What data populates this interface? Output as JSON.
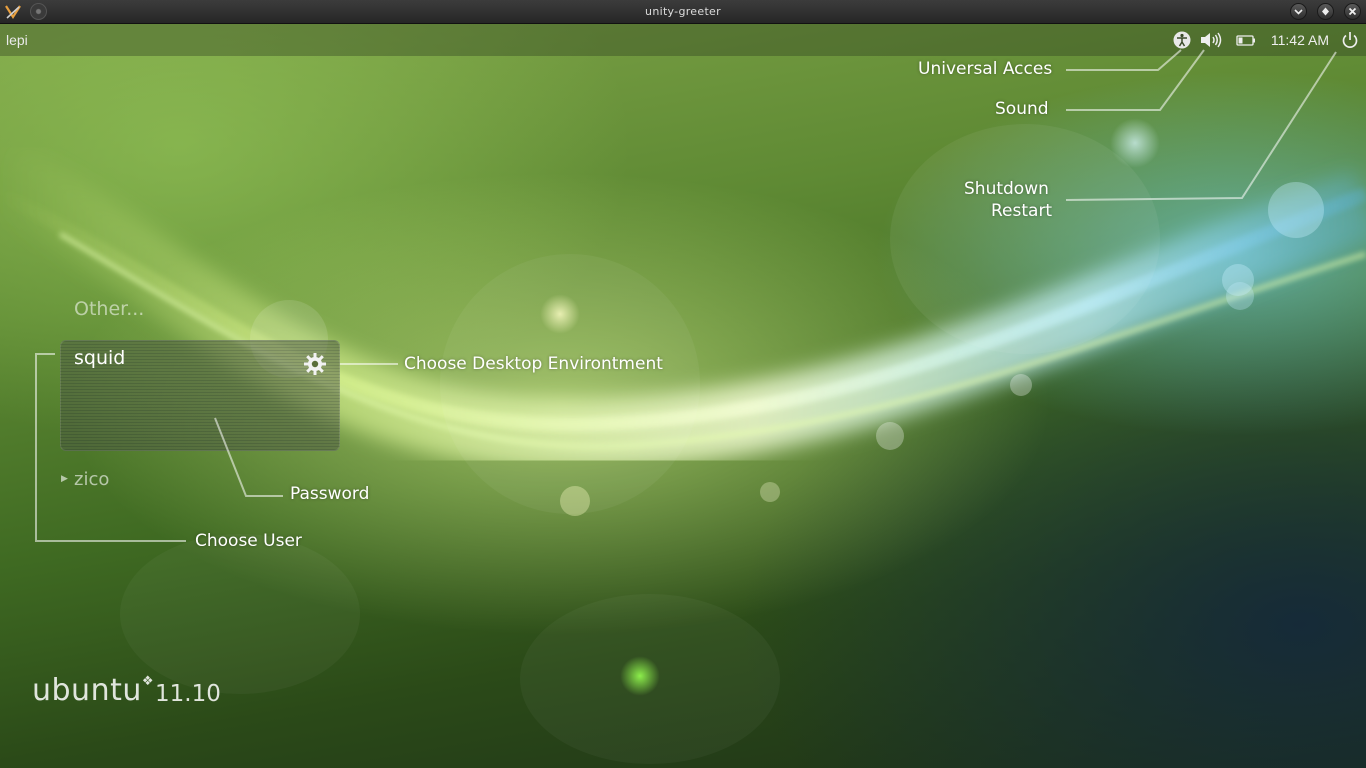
{
  "window": {
    "title": "unity-greeter",
    "buttons": [
      "minimize",
      "maximize",
      "close"
    ]
  },
  "panel": {
    "hostname": "lepi",
    "clock": "11:42 AM",
    "indicators": [
      "accessibility-icon",
      "volume-icon",
      "battery-icon",
      "power-icon"
    ]
  },
  "login": {
    "other_label": "Other...",
    "selected_user": "squid",
    "other_user": "zico"
  },
  "branding": {
    "logo_text": "ubuntu",
    "version": "11.10"
  },
  "annotations": {
    "universal_access": "Universal Acces",
    "sound": "Sound",
    "shutdown": "Shutdown",
    "restart": "Restart",
    "desktop_environment": "Choose Desktop Environtment",
    "password": "Password",
    "choose_user": "Choose User"
  }
}
